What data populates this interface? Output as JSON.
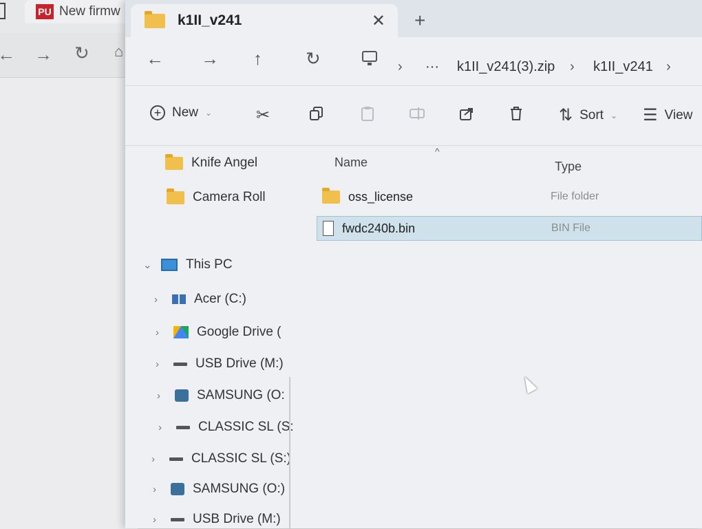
{
  "background_browser": {
    "tab_title": "New firmw",
    "logo_text": "PU",
    "nav": {
      "back_icon": "arrow-left-icon",
      "forward_icon": "arrow-right-icon",
      "refresh_icon": "refresh-icon"
    }
  },
  "explorer": {
    "tab": {
      "title": "k1II_v241",
      "close": "✕",
      "new_tab": "+"
    },
    "nav": {
      "back": "←",
      "forward": "→",
      "up": "↑",
      "refresh": "↻",
      "more": "···"
    },
    "breadcrumb": [
      "k1II_v241(3).zip",
      "k1II_v241"
    ],
    "toolbar": {
      "new_label": "New",
      "sort_label": "Sort",
      "view_label": "View"
    },
    "navpane": {
      "quick": [
        {
          "label": "Knife Angel"
        },
        {
          "label": "Camera Roll"
        }
      ],
      "this_pc": "This PC",
      "drives": [
        {
          "label": "Acer (C:)",
          "icon": "windows-drive-icon"
        },
        {
          "label": "Google Drive (",
          "icon": "google-drive-icon"
        },
        {
          "label": "USB Drive (M:)",
          "icon": "usb-drive-icon"
        },
        {
          "label": "SAMSUNG (O:",
          "icon": "samsung-drive-icon"
        },
        {
          "label": "CLASSIC SL (S:",
          "icon": "drive-icon"
        },
        {
          "label": "CLASSIC SL (S:)",
          "icon": "drive-icon"
        },
        {
          "label": "SAMSUNG (O:)",
          "icon": "samsung-drive-icon"
        },
        {
          "label": "USB Drive (M:)",
          "icon": "usb-drive-icon"
        }
      ]
    },
    "columns": {
      "name": "Name",
      "type": "Type"
    },
    "files": [
      {
        "name": "oss_license",
        "type": "File folder",
        "selected": false
      },
      {
        "name": "fwdc240b.bin",
        "type": "BIN File",
        "selected": true
      }
    ]
  }
}
